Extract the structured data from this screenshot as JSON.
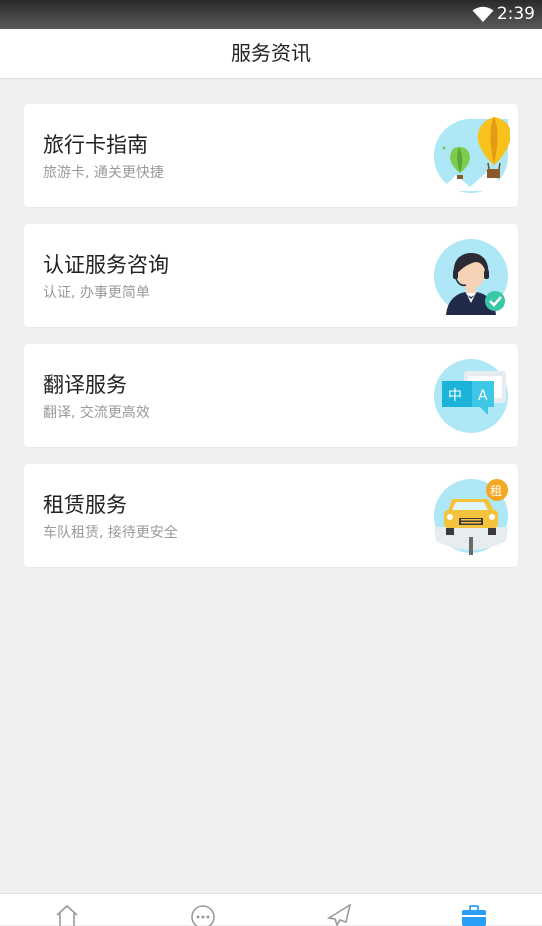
{
  "status_bar": {
    "time": "2:39",
    "wifi_icon": "wifi-icon"
  },
  "header": {
    "title": "服务资讯"
  },
  "services": [
    {
      "title": "旅行卡指南",
      "subtitle": "旅游卡, 通关更快捷",
      "icon": "hot-air-balloon-icon"
    },
    {
      "title": "认证服务咨询",
      "subtitle": "认证, 办事更简单",
      "icon": "customer-service-agent-icon"
    },
    {
      "title": "翻译服务",
      "subtitle": "翻译, 交流更高效",
      "icon": "translate-icon",
      "badge_left": "中",
      "badge_right": "A"
    },
    {
      "title": "租赁服务",
      "subtitle": "车队租赁, 接待更安全",
      "icon": "rental-car-icon",
      "badge": "租"
    }
  ],
  "tab_bar": {
    "tabs": [
      {
        "icon": "home-icon"
      },
      {
        "icon": "chat-bubble-icon"
      },
      {
        "icon": "airplane-icon"
      },
      {
        "icon": "briefcase-icon",
        "active": true
      }
    ],
    "active_color": "#2a9df4",
    "inactive_color": "#9a9a9a"
  }
}
